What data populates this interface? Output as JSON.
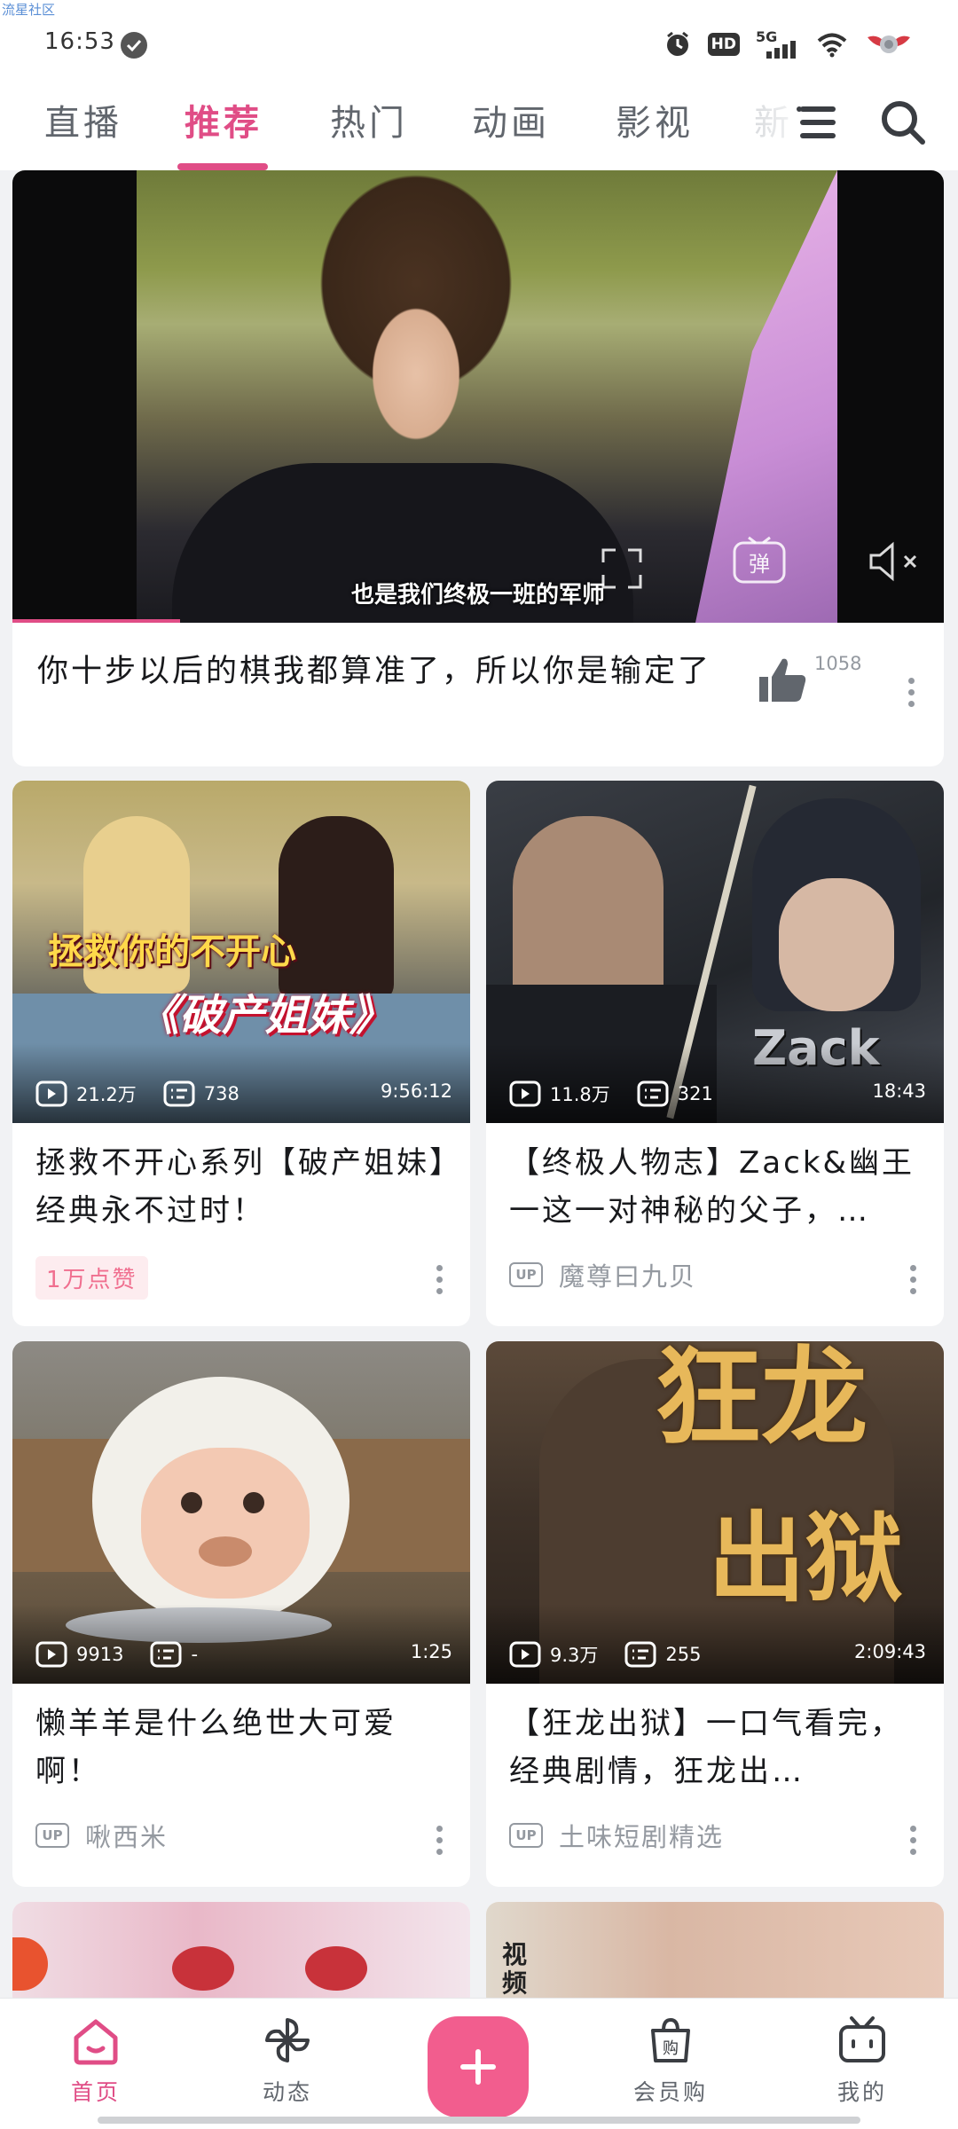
{
  "watermark": "流星社区",
  "status_bar": {
    "time": "16:53",
    "hd": "HD",
    "network": "5G",
    "icons": [
      "check-icon",
      "alarm-icon",
      "hd-icon",
      "signal-5g-icon",
      "wifi-icon",
      "profile-wing-icon"
    ]
  },
  "tabs": [
    {
      "label": "直播",
      "active": false
    },
    {
      "label": "推荐",
      "active": true
    },
    {
      "label": "热门",
      "active": false
    },
    {
      "label": "动画",
      "active": false
    },
    {
      "label": "影视",
      "active": false
    },
    {
      "label": "新",
      "active": false
    }
  ],
  "hero": {
    "subtitle": "也是我们终极一班的军师",
    "title": "你十步以后的棋我都算准了，所以你是输定了",
    "like_count": "1058",
    "progress": 0.18
  },
  "cards": [
    {
      "views": "21.2万",
      "comments": "738",
      "duration": "9:56:12",
      "title": "拯救不开心系列【破产姐妹】经典永不过时！",
      "badge": "1万点赞",
      "author": "",
      "thumb_text_1": "拯救你的不开心",
      "thumb_text_2": "《破产姐妹》"
    },
    {
      "views": "11.8万",
      "comments": "321",
      "duration": "18:43",
      "title": "【终极人物志】Zack&幽王 一这一对神秘的父子，…",
      "badge": "",
      "author": "魔尊曰九贝",
      "thumb_text_1": "Zack",
      "thumb_text_2": ""
    },
    {
      "views": "9913",
      "comments": "-",
      "duration": "1:25",
      "title": "懒羊羊是什么绝世大可爱啊！",
      "badge": "",
      "author": "啾西米",
      "thumb_text_1": "",
      "thumb_text_2": ""
    },
    {
      "views": "9.3万",
      "comments": "255",
      "duration": "2:09:43",
      "title": "【狂龙出狱】一口气看完，经典剧情，狂龙出…",
      "badge": "",
      "author": "土味短剧精选",
      "thumb_text_1": "狂龙",
      "thumb_text_2": "出狱"
    }
  ],
  "up_label": "UP",
  "partial_text": "视频",
  "bottom_nav": [
    {
      "label": "首页",
      "active": true
    },
    {
      "label": "动态",
      "active": false
    },
    {
      "label": "",
      "active": false
    },
    {
      "label": "会员购",
      "active": false
    },
    {
      "label": "我的",
      "active": false
    }
  ],
  "colors": {
    "accent": "#e04d86",
    "fab": "#f25d8e",
    "muted": "#9499a0"
  }
}
